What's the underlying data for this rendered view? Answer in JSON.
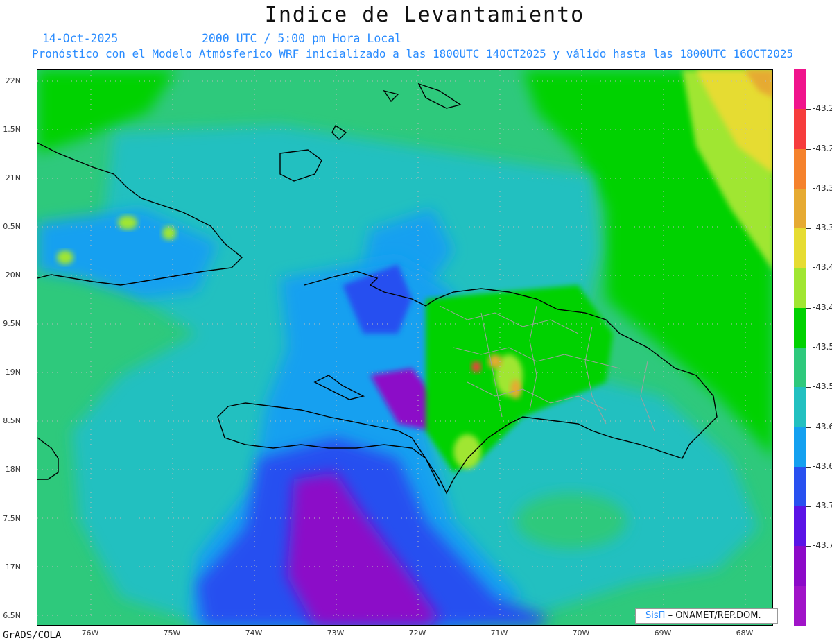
{
  "header": {
    "title": "Indice de Levantamiento",
    "date": "14-Oct-2025",
    "time": "2000 UTC / 5:00 pm Hora Local",
    "description": "Pronóstico con el Modelo Atmósferico WRF inicializado a las 1800UTC_14OCT2025 y válido hasta las  1800UTC_16OCT2025"
  },
  "axes": {
    "lat_labels": [
      "22N",
      "1.5N",
      "21N",
      "0.5N",
      "20N",
      "9.5N",
      "19N",
      "8.5N",
      "18N",
      "7.5N",
      "17N",
      "6.5N"
    ],
    "lon_labels": [
      "76W",
      "75W",
      "74W",
      "73W",
      "72W",
      "71W",
      "70W",
      "69W",
      "68W"
    ]
  },
  "legend": {
    "colors": [
      "#f0148c",
      "#f63c3c",
      "#f5822c",
      "#e6aa32",
      "#e6dc32",
      "#a0e632",
      "#00d200",
      "#2ec97c",
      "#22c0c0",
      "#14a0f0",
      "#2850f0",
      "#5a14e6",
      "#8c0ac8",
      "#a014c8"
    ],
    "labels": [
      "-43.2",
      "-43.2",
      "-43.3",
      "-43.3",
      "-43.4",
      "-43.4",
      "-43.5",
      "-43.5",
      "-43.6",
      "-43.6",
      "-43.7",
      "-43.7"
    ]
  },
  "footer": {
    "software": "GrADS/COLA",
    "credit_logo": "SisΠ",
    "credit_org": "– ONAMET/REP.DOM."
  }
}
